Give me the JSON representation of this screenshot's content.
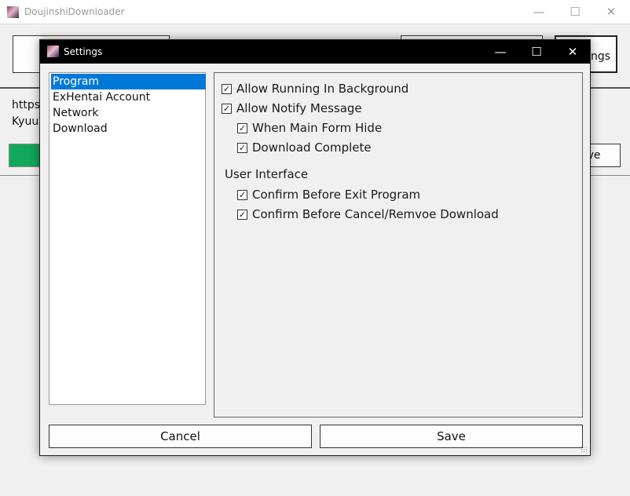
{
  "main": {
    "title": "DoujinshiDownloader",
    "controls": {
      "minimize": "—",
      "maximize": "☐",
      "close": "✕"
    },
    "settings_button_partial": "ngs",
    "url_partial": "https:",
    "name_partial": "Kyuu",
    "remove_button_partial": "ove"
  },
  "dialog": {
    "title": "Settings",
    "controls": {
      "minimize": "—",
      "maximize": "☐",
      "close": "✕"
    },
    "categories": [
      "Program",
      "ExHentai Account",
      "Network",
      "Download"
    ],
    "selected_category": "Program",
    "options": {
      "allow_running_in_background": {
        "label": "Allow Running In Background",
        "checked": true
      },
      "allow_notify_message": {
        "label": "Allow Notify Message",
        "checked": true
      },
      "when_main_form_hide": {
        "label": "When Main Form Hide",
        "checked": true
      },
      "download_complete": {
        "label": "Download Complete",
        "checked": true
      }
    },
    "user_interface": {
      "heading": "User Interface",
      "confirm_before_exit": {
        "label": "Confirm Before Exit Program",
        "checked": true
      },
      "confirm_before_cancel": {
        "label": "Confirm Before Cancel/Remvoe Download",
        "checked": true
      }
    },
    "buttons": {
      "cancel": "Cancel",
      "save": "Save"
    },
    "check_glyph": "✓"
  }
}
